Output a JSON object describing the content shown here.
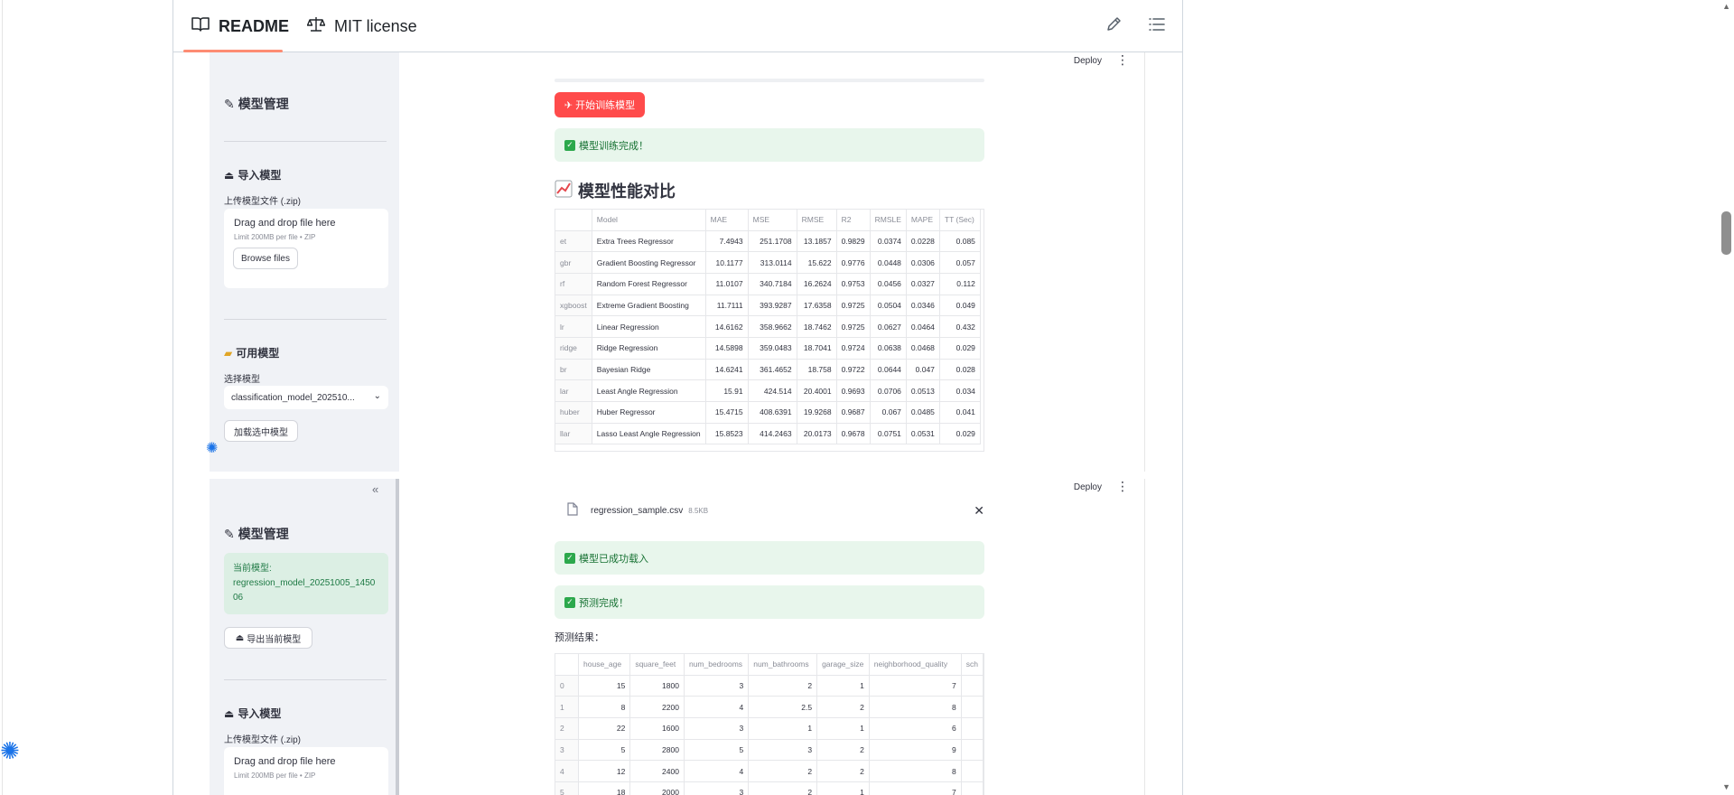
{
  "github": {
    "tabs": [
      {
        "label": "README",
        "icon": "book-icon",
        "active": true
      },
      {
        "label": "MIT license",
        "icon": "scale-icon",
        "active": false
      }
    ],
    "tools": [
      "pencil-icon",
      "list-icon"
    ]
  },
  "panel1": {
    "deploy_label": "Deploy",
    "sidebar": {
      "manage_heading": "模型管理",
      "import_heading": "导入模型",
      "upload_label": "上传模型文件 (.zip)",
      "upload_title": "Drag and drop file here",
      "upload_sub": "Limit 200MB per file • ZIP",
      "browse_label": "Browse files",
      "available_heading": "可用模型",
      "select_label": "选择模型",
      "select_value": "classification_model_202510...",
      "load_label": "加载选中模型"
    },
    "main": {
      "train_button": "开始训练模型",
      "train_done": "模型训练完成！",
      "compare_heading": "模型性能对比",
      "table": {
        "headers": [
          "",
          "Model",
          "MAE",
          "MSE",
          "RMSE",
          "R2",
          "RMSLE",
          "MAPE",
          "TT (Sec)"
        ],
        "rows": [
          [
            "et",
            "Extra Trees Regressor",
            "7.4943",
            "251.1708",
            "13.1857",
            "0.9829",
            "0.0374",
            "0.0228",
            "0.085"
          ],
          [
            "gbr",
            "Gradient Boosting Regressor",
            "10.1177",
            "313.0114",
            "15.622",
            "0.9776",
            "0.0448",
            "0.0306",
            "0.057"
          ],
          [
            "rf",
            "Random Forest Regressor",
            "11.0107",
            "340.7184",
            "16.2624",
            "0.9753",
            "0.0456",
            "0.0327",
            "0.112"
          ],
          [
            "xgboost",
            "Extreme Gradient Boosting",
            "11.7111",
            "393.9287",
            "17.6358",
            "0.9725",
            "0.0504",
            "0.0346",
            "0.049"
          ],
          [
            "lr",
            "Linear Regression",
            "14.6162",
            "358.9662",
            "18.7462",
            "0.9725",
            "0.0627",
            "0.0464",
            "0.432"
          ],
          [
            "ridge",
            "Ridge Regression",
            "14.5898",
            "359.0483",
            "18.7041",
            "0.9724",
            "0.0638",
            "0.0468",
            "0.029"
          ],
          [
            "br",
            "Bayesian Ridge",
            "14.6241",
            "361.4652",
            "18.758",
            "0.9722",
            "0.0644",
            "0.047",
            "0.028"
          ],
          [
            "lar",
            "Least Angle Regression",
            "15.91",
            "424.514",
            "20.4001",
            "0.9693",
            "0.0706",
            "0.0513",
            "0.034"
          ],
          [
            "huber",
            "Huber Regressor",
            "15.4715",
            "408.6391",
            "19.9268",
            "0.9687",
            "0.067",
            "0.0485",
            "0.041"
          ],
          [
            "llar",
            "Lasso Least Angle Regression",
            "15.8523",
            "414.2463",
            "20.0173",
            "0.9678",
            "0.0751",
            "0.0531",
            "0.029"
          ]
        ]
      }
    }
  },
  "panel2": {
    "deploy_label": "Deploy",
    "sidebar": {
      "collapse_label": "«",
      "manage_heading": "模型管理",
      "current_label": "当前模型:",
      "current_value": "regression_model_20251005_145006",
      "export_label": "导出当前模型",
      "import_heading": "导入模型",
      "upload_label": "上传模型文件 (.zip)",
      "upload_title": "Drag and drop file here",
      "upload_sub": "Limit 200MB per file • ZIP"
    },
    "main": {
      "file_name": "regression_sample.csv",
      "file_size": "8.5KB",
      "loaded_msg": "模型已成功载入",
      "predict_msg": "预测完成！",
      "result_label": "预测结果：",
      "table": {
        "headers": [
          "",
          "house_age",
          "square_feet",
          "num_bedrooms",
          "num_bathrooms",
          "garage_size",
          "neighborhood_quality",
          "sch"
        ],
        "rows": [
          [
            "0",
            "15",
            "1800",
            "3",
            "2",
            "1",
            "7",
            ""
          ],
          [
            "1",
            "8",
            "2200",
            "4",
            "2.5",
            "2",
            "8",
            ""
          ],
          [
            "2",
            "22",
            "1600",
            "3",
            "1",
            "1",
            "6",
            ""
          ],
          [
            "3",
            "5",
            "2800",
            "5",
            "3",
            "2",
            "9",
            ""
          ],
          [
            "4",
            "12",
            "2400",
            "4",
            "2",
            "2",
            "8",
            ""
          ],
          [
            "5",
            "18",
            "2000",
            "3",
            "2",
            "1",
            "7",
            ""
          ]
        ]
      }
    }
  },
  "colors": {
    "primary": "#ff4b4b",
    "success_bg": "#e8f6ec",
    "success_text": "#177233",
    "sidebar_bg": "#f0f2f6",
    "tab_underline": "#fd8c73"
  }
}
